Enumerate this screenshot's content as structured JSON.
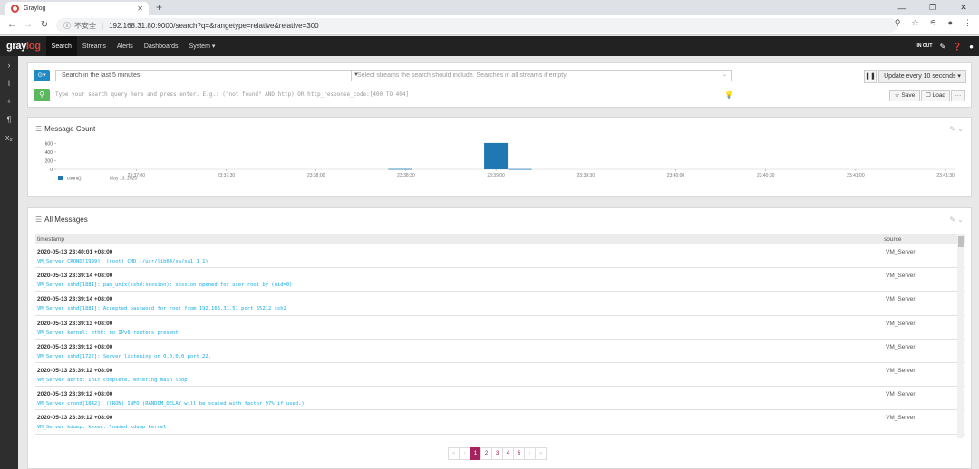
{
  "browser": {
    "tab_title": "Graylog",
    "address_insecure": "不安全",
    "url": "192.168.31.80:9000/search?q=&rangetype=relative&relative=300"
  },
  "nav": {
    "logo_gray": "gray",
    "logo_log": "log",
    "items": [
      "Search",
      "Streams",
      "Alerts",
      "Dashboards",
      "System ▾"
    ],
    "inout": "IN OUT"
  },
  "search": {
    "range_label": "Search in the last 5 minutes",
    "streams_placeholder": "Select streams the search should include. Searches in all streams if empty.",
    "query_placeholder": "Type your search query here and press enter. E.g.: (\"not found\" AND http) OR http_response_code:[400 TO 404]",
    "refresh_label": "Update every 10 seconds ▾",
    "save_label": "☆ Save",
    "load_label": "☐ Load",
    "more_label": "···"
  },
  "count_panel": {
    "title": "Message Count"
  },
  "chart_data": {
    "type": "bar",
    "title": "Message Count",
    "x": [
      "23:37:00",
      "23:37:30",
      "23:38:00",
      "23:38:30",
      "23:39:00",
      "23:39:30",
      "23:40:00",
      "23:40:30",
      "23:41:00",
      "23:41:30"
    ],
    "date_label": "May 13, 2020",
    "bars": [
      {
        "time": "23:38:28",
        "value": 8
      },
      {
        "time": "23:39:00",
        "value": 610
      },
      {
        "time": "23:39:08",
        "value": 6
      }
    ],
    "y_ticks": [
      0,
      200,
      400,
      600
    ],
    "ylim": [
      0,
      650
    ],
    "legend": "count()",
    "color": "#1f78b4"
  },
  "messages_panel": {
    "title": "All Messages",
    "col_timestamp": "timestamp",
    "col_source": "source",
    "rows": [
      {
        "ts": "2020-05-13 23:40:01 +08:00",
        "msg": "VM_Server CROND[1999]: (root) CMD (/usr/lib64/sa/sa1 1 1)",
        "src": "VM_Server"
      },
      {
        "ts": "2020-05-13 23:39:14 +08:00",
        "msg": "VM_Server sshd[1881]: pam_unix(sshd:session): session opened for user root by (uid=0)",
        "src": "VM_Server"
      },
      {
        "ts": "2020-05-13 23:39:14 +08:00",
        "msg": "VM_Server sshd[1881]: Accepted password for root from 192.168.31.51 port 55212 ssh2",
        "src": "VM_Server"
      },
      {
        "ts": "2020-05-13 23:39:13 +08:00",
        "msg": "VM_Server kernel: eth0: no IPv6 routers present",
        "src": "VM_Server"
      },
      {
        "ts": "2020-05-13 23:39:12 +08:00",
        "msg": "VM_Server sshd[1722]: Server listening on 0.0.0.0 port 22.",
        "src": "VM_Server"
      },
      {
        "ts": "2020-05-13 23:39:12 +08:00",
        "msg": "VM_Server abrtd: Init complete, entering main loop",
        "src": "VM_Server"
      },
      {
        "ts": "2020-05-13 23:39:12 +08:00",
        "msg": "VM_Server crond[1842]: (CRON) INFO (RANDOM_DELAY will be scaled with factor 97% if used.)",
        "src": "VM_Server"
      },
      {
        "ts": "2020-05-13 23:39:12 +08:00",
        "msg": "VM_Server kdump: kexec: loaded kdump kernel",
        "src": "VM_Server"
      }
    ]
  },
  "pager": [
    "«",
    "‹",
    "1",
    "2",
    "3",
    "4",
    "5",
    "›",
    "»"
  ]
}
